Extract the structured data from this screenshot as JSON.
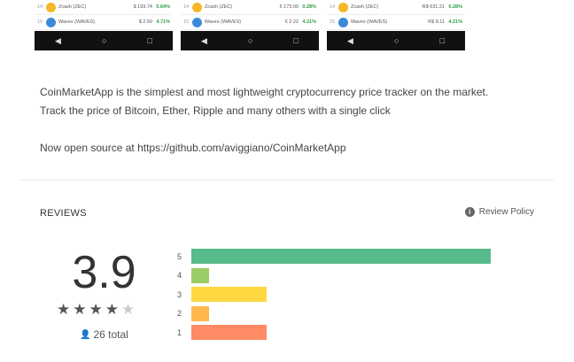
{
  "screenshots": [
    {
      "rows": [
        {
          "rank": "14",
          "name": "Zcash (ZEC)",
          "price": "$ 193.74",
          "pct": "0.64%",
          "color": "#f4b728"
        },
        {
          "rank": "15",
          "name": "Waves (WAVES)",
          "price": "$ 2.50",
          "pct": "4.71%",
          "color": "#3b8ad8"
        }
      ]
    },
    {
      "rows": [
        {
          "rank": "14",
          "name": "Zcash (ZEC)",
          "price": "€ 173.09",
          "pct": "0.28%",
          "color": "#f4b728"
        },
        {
          "rank": "15",
          "name": "Waves (WAVES)",
          "price": "€ 2.22",
          "pct": "4.21%",
          "color": "#3b8ad8"
        }
      ]
    },
    {
      "rows": [
        {
          "rank": "14",
          "name": "Zcash (ZEC)",
          "price": "R$ 631.21",
          "pct": "0.28%",
          "color": "#f4b728"
        },
        {
          "rank": "15",
          "name": "Waves (WAVES)",
          "price": "R$ 8.11",
          "pct": "4.21%",
          "color": "#3b8ad8"
        }
      ]
    }
  ],
  "description": {
    "line1": "CoinMarketApp is the simplest and most lightweight cryptocurrency price tracker on the market.",
    "line2": "Track the price of Bitcoin, Ether, Ripple and many others with a single click",
    "line3": "Now open source at https://github.com/aviggiano/CoinMarketApp"
  },
  "reviews": {
    "title": "REVIEWS",
    "policy_label": "Review Policy",
    "score": "3.9",
    "stars_filled": 4,
    "stars_total": 5,
    "total_label": "26 total",
    "histogram": [
      {
        "label": "5",
        "fraction": 1.0,
        "color": "#57bb8a"
      },
      {
        "label": "4",
        "fraction": 0.06,
        "color": "#9ccc65"
      },
      {
        "label": "3",
        "fraction": 0.25,
        "color": "#ffd740"
      },
      {
        "label": "2",
        "fraction": 0.06,
        "color": "#ffb74d"
      },
      {
        "label": "1",
        "fraction": 0.25,
        "color": "#ff8a65"
      }
    ]
  }
}
